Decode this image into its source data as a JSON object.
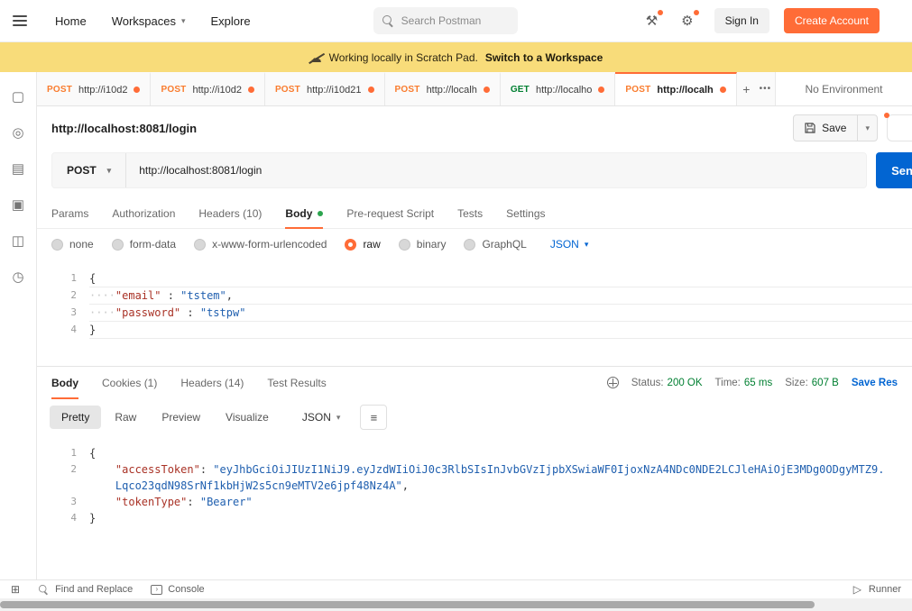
{
  "header": {
    "nav": [
      "Home",
      "Workspaces",
      "Explore"
    ],
    "search_placeholder": "Search Postman",
    "sign_in": "Sign In",
    "create_account": "Create Account"
  },
  "banner": {
    "message": "Working locally in Scratch Pad.",
    "action": "Switch to a Workspace"
  },
  "icons": {
    "cloud_offline": "☁",
    "tools": "⚒",
    "gear": "⚙",
    "chevron": "▾",
    "wrap": "≡",
    "grid": "⊞",
    "runner": "▷"
  },
  "sidebar": {
    "icons": [
      {
        "name": "collections-icon",
        "glyph": "▢"
      },
      {
        "name": "apis-icon",
        "glyph": "◎"
      },
      {
        "name": "environments-icon",
        "glyph": "▤"
      },
      {
        "name": "mock-servers-icon",
        "glyph": "▣"
      },
      {
        "name": "monitors-icon",
        "glyph": "◫"
      },
      {
        "name": "history-icon",
        "glyph": "◷"
      }
    ]
  },
  "tabbar": {
    "tabs": [
      {
        "method": "POST",
        "title": "http://i10d2"
      },
      {
        "method": "POST",
        "title": "http://i10d2"
      },
      {
        "method": "POST",
        "title": "http://i10d21"
      },
      {
        "method": "POST",
        "title": "http://localh"
      },
      {
        "method": "GET",
        "title": "http://localho"
      },
      {
        "method": "POST",
        "title": "http://localh"
      }
    ],
    "add": "+",
    "more": "•••",
    "environment": "No Environment"
  },
  "request": {
    "title": "http://localhost:8081/login",
    "save": "Save",
    "method": "POST",
    "url": "http://localhost:8081/login",
    "send": "Send",
    "tabs": [
      "Params",
      "Authorization",
      "Headers (10)",
      "Body",
      "Pre-request Script",
      "Tests",
      "Settings"
    ],
    "body_modes": [
      "none",
      "form-data",
      "x-www-form-urlencoded",
      "raw",
      "binary",
      "GraphQL"
    ],
    "language": "JSON",
    "code": {
      "l1": {
        "n": "1",
        "brace": "{"
      },
      "l2": {
        "n": "2",
        "ws": "····",
        "key": "\"email\"",
        "sep": " : ",
        "val": "\"tstem\"",
        "comma": ","
      },
      "l3": {
        "n": "3",
        "ws": "····",
        "key": "\"password\"",
        "sep": " : ",
        "val": "\"tstpw\""
      },
      "l4": {
        "n": "4",
        "brace": "}"
      }
    }
  },
  "response": {
    "tabs": [
      "Body",
      "Cookies (1)",
      "Headers (14)",
      "Test Results"
    ],
    "status_label": "Status:",
    "status_value": "200 OK",
    "time_label": "Time:",
    "time_value": "65 ms",
    "size_label": "Size:",
    "size_value": "607 B",
    "save_response": "Save Res",
    "views": [
      "Pretty",
      "Raw",
      "Preview",
      "Visualize"
    ],
    "language": "JSON",
    "code": {
      "l1": {
        "n": "1",
        "brace": "{"
      },
      "l2": {
        "n": "2",
        "indent": "    ",
        "key": "\"accessToken\"",
        "sep": ": ",
        "val": "\"eyJhbGciOiJIUzI1NiJ9.eyJzdWIiOiJ0c3RlbSIsInJvbGVzIjpbXSwiaWF0IjoxNzA4NDc0NDE2LCJleHAiOjE3MDg0ODgyMTZ9.Lqco23qdN98SrNf1kbHjW2s5cn9eMTV2e6jpf48Nz4A\"",
        "comma": ","
      },
      "l3": {
        "n": "3",
        "indent": "    ",
        "key": "\"tokenType\"",
        "sep": ": ",
        "val": "\"Bearer\""
      },
      "l4": {
        "n": "4",
        "brace": "}"
      }
    }
  },
  "footer": {
    "find": "Find and Replace",
    "console": "Console",
    "runner": "Runner"
  },
  "colors": {
    "accent_orange": "#FF6C37",
    "send_button_blue": "#0265D2",
    "status_ok_green": "#007F31",
    "banner_yellow": "#F8DC7A",
    "method_post": "#F97C2E",
    "method_get": "#007F31",
    "json_key": "#A93226",
    "json_string": "#1F5FAF"
  }
}
